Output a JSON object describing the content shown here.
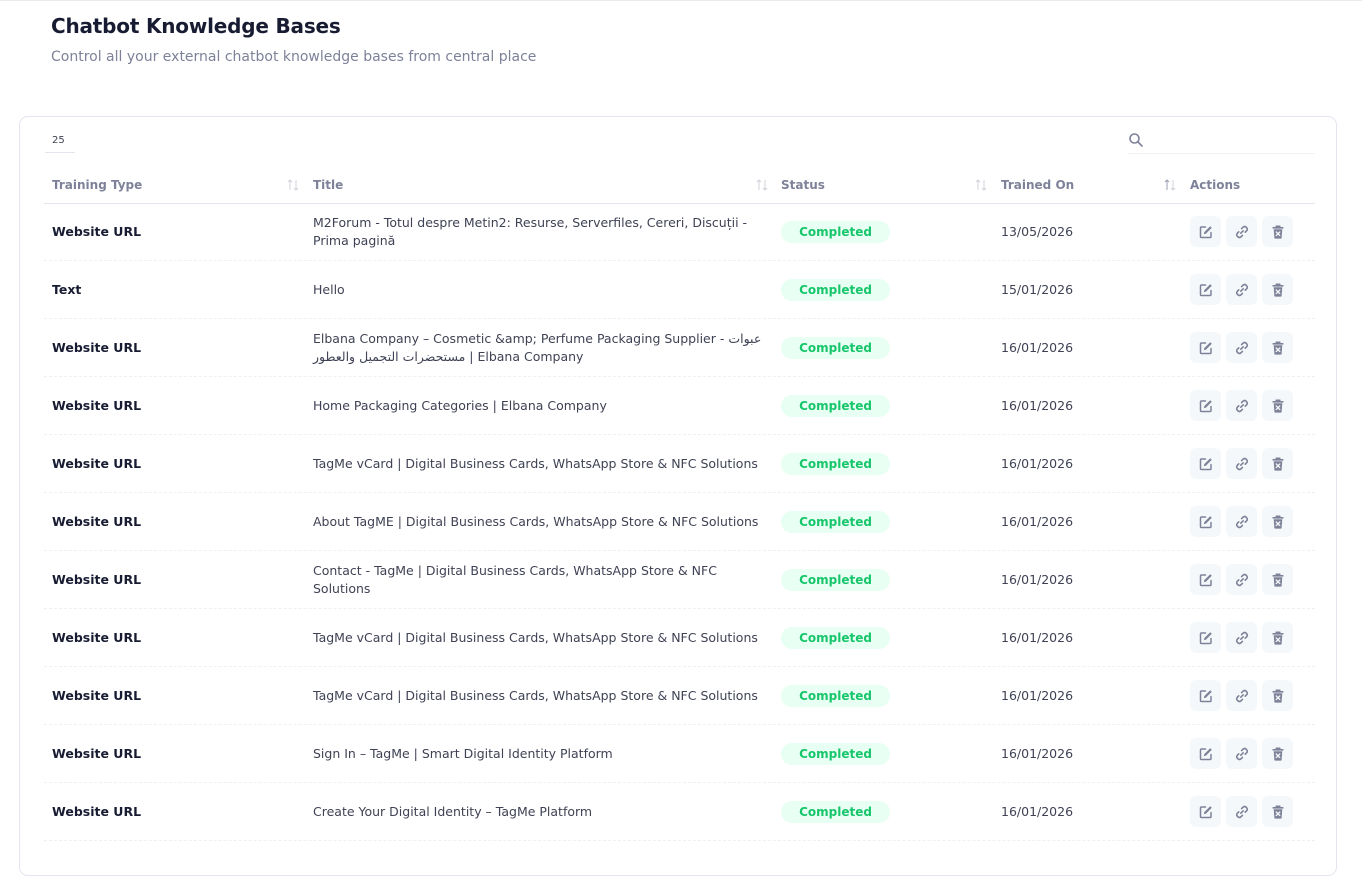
{
  "header": {
    "title": "Chatbot Knowledge Bases",
    "subtitle": "Control all your external chatbot knowledge bases from central place"
  },
  "toolbar": {
    "page_size": "25",
    "search_placeholder": ""
  },
  "table": {
    "columns": [
      "Training Type",
      "Title",
      "Status",
      "Trained On",
      "Actions"
    ],
    "rows": [
      {
        "type": "Website URL",
        "title": "M2Forum - Totul despre Metin2: Resurse, Serverfiles, Cereri, Discuții - Prima pagină",
        "status": "Completed",
        "date": "13/05/2026"
      },
      {
        "type": "Text",
        "title": "Hello",
        "status": "Completed",
        "date": "15/01/2026"
      },
      {
        "type": "Website URL",
        "title": "Elbana Company – Cosmetic &amp; Perfume Packaging Supplier - عبوات مستحضرات التجميل والعطور | Elbana Company",
        "status": "Completed",
        "date": "16/01/2026"
      },
      {
        "type": "Website URL",
        "title": "Home Packaging Categories | Elbana Company",
        "status": "Completed",
        "date": "16/01/2026"
      },
      {
        "type": "Website URL",
        "title": "TagMe vCard | Digital Business Cards, WhatsApp Store & NFC Solutions",
        "status": "Completed",
        "date": "16/01/2026"
      },
      {
        "type": "Website URL",
        "title": "About TagME | Digital Business Cards, WhatsApp Store & NFC Solutions",
        "status": "Completed",
        "date": "16/01/2026"
      },
      {
        "type": "Website URL",
        "title": "Contact - TagMe | Digital Business Cards, WhatsApp Store & NFC Solutions",
        "status": "Completed",
        "date": "16/01/2026"
      },
      {
        "type": "Website URL",
        "title": "TagMe vCard | Digital Business Cards, WhatsApp Store & NFC Solutions",
        "status": "Completed",
        "date": "16/01/2026"
      },
      {
        "type": "Website URL",
        "title": "TagMe vCard | Digital Business Cards, WhatsApp Store & NFC Solutions",
        "status": "Completed",
        "date": "16/01/2026"
      },
      {
        "type": "Website URL",
        "title": "Sign In – TagMe | Smart Digital Identity Platform",
        "status": "Completed",
        "date": "16/01/2026"
      },
      {
        "type": "Website URL",
        "title": "Create Your Digital Identity – TagMe Platform",
        "status": "Completed",
        "date": "16/01/2026"
      }
    ],
    "action_icons": [
      "edit-icon",
      "link-icon",
      "trash-icon"
    ]
  },
  "colors": {
    "status_bg": "#e8fff3",
    "status_text": "#17c66b",
    "heading": "#181c32",
    "muted": "#7e8299"
  }
}
